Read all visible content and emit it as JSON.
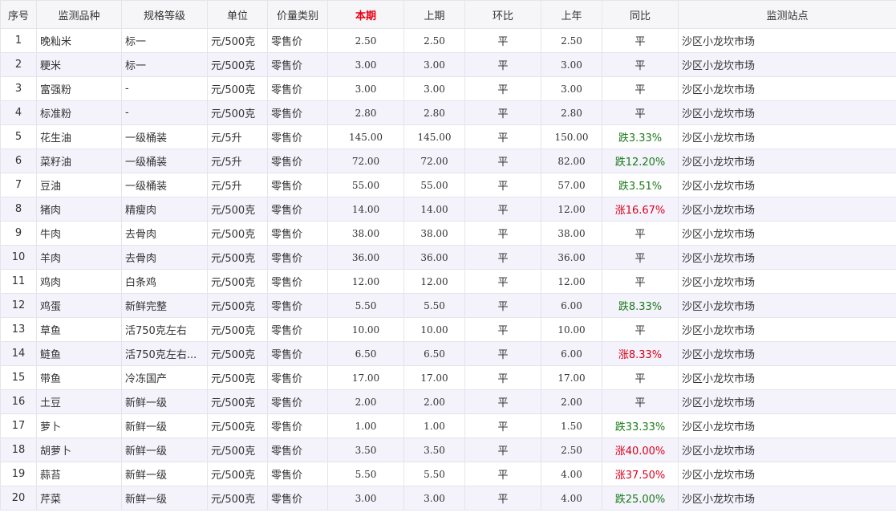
{
  "headers": [
    "序号",
    "监测品种",
    "规格等级",
    "单位",
    "价量类别",
    "本期",
    "上期",
    "环比",
    "上年",
    "同比",
    "监测站点"
  ],
  "rows": [
    {
      "no": "1",
      "name": "晚籼米",
      "spec": "标一",
      "unit": "元/500克",
      "type": "零售价",
      "cur": "2.50",
      "prev": "2.50",
      "mom": "平",
      "last_year": "2.50",
      "yoy": "平",
      "yoy_dir": "flat",
      "site": "沙区小龙坎市场"
    },
    {
      "no": "2",
      "name": "粳米",
      "spec": "标一",
      "unit": "元/500克",
      "type": "零售价",
      "cur": "3.00",
      "prev": "3.00",
      "mom": "平",
      "last_year": "3.00",
      "yoy": "平",
      "yoy_dir": "flat",
      "site": "沙区小龙坎市场"
    },
    {
      "no": "3",
      "name": "富强粉",
      "spec": "-",
      "unit": "元/500克",
      "type": "零售价",
      "cur": "3.00",
      "prev": "3.00",
      "mom": "平",
      "last_year": "3.00",
      "yoy": "平",
      "yoy_dir": "flat",
      "site": "沙区小龙坎市场"
    },
    {
      "no": "4",
      "name": "标准粉",
      "spec": "-",
      "unit": "元/500克",
      "type": "零售价",
      "cur": "2.80",
      "prev": "2.80",
      "mom": "平",
      "last_year": "2.80",
      "yoy": "平",
      "yoy_dir": "flat",
      "site": "沙区小龙坎市场"
    },
    {
      "no": "5",
      "name": "花生油",
      "spec": "一级桶装",
      "unit": "元/5升",
      "type": "零售价",
      "cur": "145.00",
      "prev": "145.00",
      "mom": "平",
      "last_year": "150.00",
      "yoy": "跌3.33%",
      "yoy_dir": "down",
      "site": "沙区小龙坎市场"
    },
    {
      "no": "6",
      "name": "菜籽油",
      "spec": "一级桶装",
      "unit": "元/5升",
      "type": "零售价",
      "cur": "72.00",
      "prev": "72.00",
      "mom": "平",
      "last_year": "82.00",
      "yoy": "跌12.20%",
      "yoy_dir": "down",
      "site": "沙区小龙坎市场"
    },
    {
      "no": "7",
      "name": "豆油",
      "spec": "一级桶装",
      "unit": "元/5升",
      "type": "零售价",
      "cur": "55.00",
      "prev": "55.00",
      "mom": "平",
      "last_year": "57.00",
      "yoy": "跌3.51%",
      "yoy_dir": "down",
      "site": "沙区小龙坎市场"
    },
    {
      "no": "8",
      "name": "猪肉",
      "spec": "精瘦肉",
      "unit": "元/500克",
      "type": "零售价",
      "cur": "14.00",
      "prev": "14.00",
      "mom": "平",
      "last_year": "12.00",
      "yoy": "涨16.67%",
      "yoy_dir": "up",
      "site": "沙区小龙坎市场"
    },
    {
      "no": "9",
      "name": "牛肉",
      "spec": "去骨肉",
      "unit": "元/500克",
      "type": "零售价",
      "cur": "38.00",
      "prev": "38.00",
      "mom": "平",
      "last_year": "38.00",
      "yoy": "平",
      "yoy_dir": "flat",
      "site": "沙区小龙坎市场"
    },
    {
      "no": "10",
      "name": "羊肉",
      "spec": "去骨肉",
      "unit": "元/500克",
      "type": "零售价",
      "cur": "36.00",
      "prev": "36.00",
      "mom": "平",
      "last_year": "36.00",
      "yoy": "平",
      "yoy_dir": "flat",
      "site": "沙区小龙坎市场"
    },
    {
      "no": "11",
      "name": "鸡肉",
      "spec": "白条鸡",
      "unit": "元/500克",
      "type": "零售价",
      "cur": "12.00",
      "prev": "12.00",
      "mom": "平",
      "last_year": "12.00",
      "yoy": "平",
      "yoy_dir": "flat",
      "site": "沙区小龙坎市场"
    },
    {
      "no": "12",
      "name": "鸡蛋",
      "spec": "新鲜完整",
      "unit": "元/500克",
      "type": "零售价",
      "cur": "5.50",
      "prev": "5.50",
      "mom": "平",
      "last_year": "6.00",
      "yoy": "跌8.33%",
      "yoy_dir": "down",
      "site": "沙区小龙坎市场"
    },
    {
      "no": "13",
      "name": "草鱼",
      "spec": "活750克左右",
      "unit": "元/500克",
      "type": "零售价",
      "cur": "10.00",
      "prev": "10.00",
      "mom": "平",
      "last_year": "10.00",
      "yoy": "平",
      "yoy_dir": "flat",
      "site": "沙区小龙坎市场"
    },
    {
      "no": "14",
      "name": "鲢鱼",
      "spec": "活750克左右...",
      "unit": "元/500克",
      "type": "零售价",
      "cur": "6.50",
      "prev": "6.50",
      "mom": "平",
      "last_year": "6.00",
      "yoy": "涨8.33%",
      "yoy_dir": "up",
      "site": "沙区小龙坎市场"
    },
    {
      "no": "15",
      "name": "带鱼",
      "spec": "冷冻国产",
      "unit": "元/500克",
      "type": "零售价",
      "cur": "17.00",
      "prev": "17.00",
      "mom": "平",
      "last_year": "17.00",
      "yoy": "平",
      "yoy_dir": "flat",
      "site": "沙区小龙坎市场"
    },
    {
      "no": "16",
      "name": "土豆",
      "spec": "新鲜一级",
      "unit": "元/500克",
      "type": "零售价",
      "cur": "2.00",
      "prev": "2.00",
      "mom": "平",
      "last_year": "2.00",
      "yoy": "平",
      "yoy_dir": "flat",
      "site": "沙区小龙坎市场"
    },
    {
      "no": "17",
      "name": "萝卜",
      "spec": "新鲜一级",
      "unit": "元/500克",
      "type": "零售价",
      "cur": "1.00",
      "prev": "1.00",
      "mom": "平",
      "last_year": "1.50",
      "yoy": "跌33.33%",
      "yoy_dir": "down",
      "site": "沙区小龙坎市场"
    },
    {
      "no": "18",
      "name": "胡萝卜",
      "spec": "新鲜一级",
      "unit": "元/500克",
      "type": "零售价",
      "cur": "3.50",
      "prev": "3.50",
      "mom": "平",
      "last_year": "2.50",
      "yoy": "涨40.00%",
      "yoy_dir": "up",
      "site": "沙区小龙坎市场"
    },
    {
      "no": "19",
      "name": "蒜苔",
      "spec": "新鲜一级",
      "unit": "元/500克",
      "type": "零售价",
      "cur": "5.50",
      "prev": "5.50",
      "mom": "平",
      "last_year": "4.00",
      "yoy": "涨37.50%",
      "yoy_dir": "up",
      "site": "沙区小龙坎市场"
    },
    {
      "no": "20",
      "name": "芹菜",
      "spec": "新鲜一级",
      "unit": "元/500克",
      "type": "零售价",
      "cur": "3.00",
      "prev": "3.00",
      "mom": "平",
      "last_year": "4.00",
      "yoy": "跌25.00%",
      "yoy_dir": "down",
      "site": "沙区小龙坎市场"
    }
  ],
  "colors": {
    "highlight_header": "#e60012",
    "down": "#1a7a1a",
    "up": "#d9001b",
    "stripe": "#f4f2fb"
  }
}
